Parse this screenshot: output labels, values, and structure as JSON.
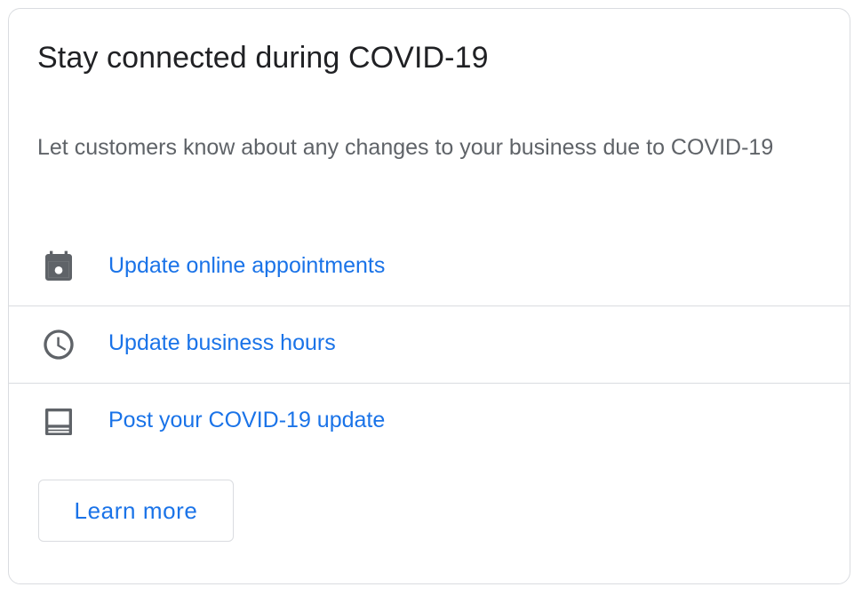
{
  "card": {
    "title": "Stay connected during COVID-19",
    "description": "Let customers know about any changes to your business due to COVID-19",
    "actions": [
      {
        "icon": "calendar-event-icon",
        "label": "Update online appointments"
      },
      {
        "icon": "clock-icon",
        "label": "Update business hours"
      },
      {
        "icon": "post-update-icon",
        "label": "Post your COVID-19 update"
      }
    ],
    "learn_more_label": "Learn more"
  },
  "colors": {
    "link": "#1a73e8",
    "title": "#202124",
    "secondary_text": "#5f6368",
    "icon": "#5f6368",
    "divider": "#dadce0"
  }
}
